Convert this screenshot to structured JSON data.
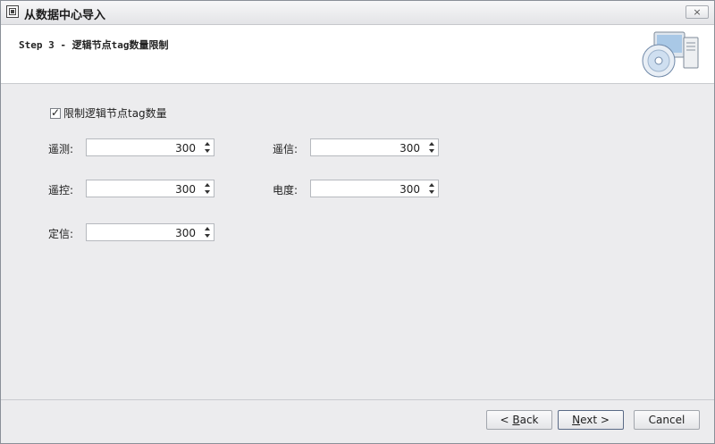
{
  "window": {
    "title": "从数据中心导入",
    "close_label": "×"
  },
  "header": {
    "step_title": "Step 3 - 逻辑节点tag数量限制"
  },
  "limit_checkbox": {
    "label": "限制逻辑节点tag数量",
    "checked": true
  },
  "fields": [
    {
      "label": "遥测:",
      "value": "300"
    },
    {
      "label": "遥信:",
      "value": "300"
    },
    {
      "label": "遥控:",
      "value": "300"
    },
    {
      "label": "电度:",
      "value": "300"
    },
    {
      "label": "定信:",
      "value": "300"
    }
  ],
  "buttons": {
    "back_prefix": "< ",
    "back_key": "B",
    "back_rest": "ack",
    "next_key": "N",
    "next_rest": "ext >",
    "cancel": "Cancel"
  },
  "icons": [
    "app-window-icon",
    "install-computer-disc-icon",
    "spin-up-icon",
    "spin-down-icon",
    "close-icon",
    "checkbox-checked-icon"
  ]
}
